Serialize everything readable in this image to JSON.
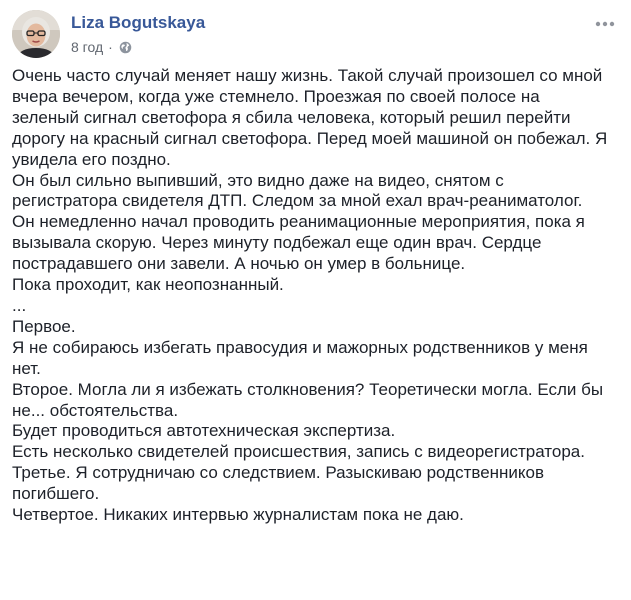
{
  "post": {
    "author": "Liza Bogutskaya",
    "timestamp": "8 год",
    "separator": "·",
    "privacy_icon": "globe-icon",
    "more_icon": "more-options-icon",
    "lines": [
      "Очень часто случай меняет нашу жизнь. Такой случай произошел со мной",
      "вчера вечером, когда уже стемнело. Проезжая по своей полосе на",
      "зеленый сигнал светофора я сбила человека, который решил перейти",
      "дорогу на красный сигнал светофора. Перед моей машиной он побежал. Я",
      "увидела его поздно.",
      "Он был сильно выпивший, это видно даже на видео, снятом с",
      "регистратора свидетеля ДТП. Следом за мной ехал врач-реаниматолог.",
      "Он немедленно начал проводить реанимационные мероприятия, пока я",
      "вызывала скорую. Через минуту подбежал еще один врач. Сердце",
      "пострадавшего они завели. А ночью он умер в больнице.",
      "Пока проходит, как неопознанный.",
      "...",
      "Первое.",
      "Я не собираюсь избегать правосудия и мажорных родственников у меня",
      "нет.",
      "Второе. Могла ли я избежать столкновения? Теоретически могла. Если бы",
      "не... обстоятельства.",
      "Будет проводиться автотехническая экспертиза.",
      "Есть несколько свидетелей происшествия, запись с видеорегистратора.",
      "Третье. Я сотрудничаю со следствием. Разыскиваю родственников",
      "погибшего.",
      "Четвертое. Никаких интервью журналистам пока не даю."
    ]
  }
}
